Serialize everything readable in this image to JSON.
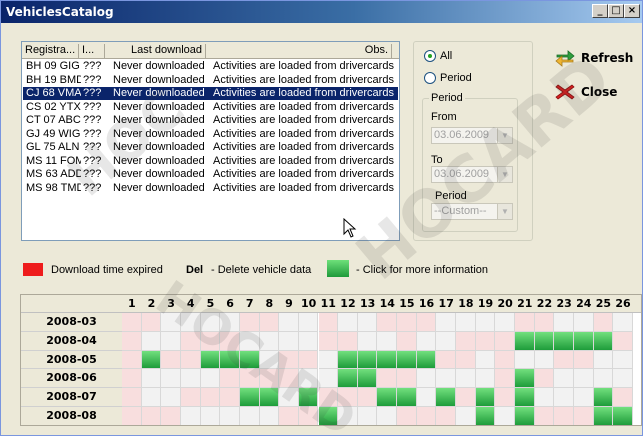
{
  "window": {
    "title": "VehiclesCatalog",
    "minimize": "_",
    "maximize": "□",
    "close": "×"
  },
  "list": {
    "columns": [
      "Registra...",
      "I...",
      "Last download",
      "Obs."
    ],
    "rows": [
      {
        "reg": "BH 09 GIG",
        "id": "???",
        "last": "Never downloaded",
        "obs": "Activities are loaded from drivercards"
      },
      {
        "reg": "BH 19 BMD",
        "id": "???",
        "last": "Never downloaded",
        "obs": "Activities are loaded from drivercards"
      },
      {
        "reg": "CJ 68 VMA",
        "id": "???",
        "last": "Never downloaded",
        "obs": "Activities are loaded from drivercards"
      },
      {
        "reg": "CS 02 YTX",
        "id": "???",
        "last": "Never downloaded",
        "obs": "Activities are loaded from drivercards"
      },
      {
        "reg": "CT 07 ABC",
        "id": "???",
        "last": "Never downloaded",
        "obs": "Activities are loaded from drivercards"
      },
      {
        "reg": "GJ 49 WIG",
        "id": "???",
        "last": "Never downloaded",
        "obs": "Activities are loaded from drivercards"
      },
      {
        "reg": "GL 75 ALN",
        "id": "???",
        "last": "Never downloaded",
        "obs": "Activities are loaded from drivercards"
      },
      {
        "reg": "MS 11 FOM",
        "id": "???",
        "last": "Never downloaded",
        "obs": "Activities are loaded from drivercards"
      },
      {
        "reg": "MS 63 ADD",
        "id": "???",
        "last": "Never downloaded",
        "obs": "Activities are loaded from drivercards"
      },
      {
        "reg": "MS 98 TMD",
        "id": "???",
        "last": "Never downloaded",
        "obs": "Activities are loaded from drivercards"
      }
    ],
    "selected_index": 2
  },
  "filter": {
    "all_label": "All",
    "period_label": "Period",
    "selected": "all",
    "group_title": "Period",
    "from_label": "From",
    "from_value": "03.06.2009",
    "to_label": "To",
    "to_value": "03.06.2009",
    "period_select_label": "Period",
    "period_select_value": "--Custom--"
  },
  "actions": {
    "refresh": "Refresh",
    "close": "Close"
  },
  "legend": {
    "expired_label": "Download time expired",
    "del_key": "Del",
    "del_label": "- Delete vehicle data",
    "info_label": "- Click for more information"
  },
  "calendar": {
    "days": [
      "1",
      "2",
      "3",
      "4",
      "5",
      "6",
      "7",
      "8",
      "9",
      "10",
      "11",
      "12",
      "13",
      "14",
      "15",
      "16",
      "17",
      "18",
      "19",
      "20",
      "21",
      "22",
      "23",
      "24",
      "25",
      "26"
    ],
    "months": [
      "2008-03",
      "2008-04",
      "2008-05",
      "2008-06",
      "2008-07",
      "2008-08"
    ],
    "expired": [
      [
        1,
        2,
        7,
        8,
        11,
        14,
        15,
        16,
        21,
        22,
        25
      ],
      [
        1,
        4,
        5,
        6,
        11,
        12,
        15,
        18,
        19,
        20,
        25,
        26
      ],
      [
        1,
        3,
        4,
        5,
        9,
        10,
        16,
        17,
        18,
        20,
        23,
        24
      ],
      [
        1,
        6,
        7,
        8,
        9,
        14,
        15,
        20,
        21,
        22
      ],
      [
        1,
        4,
        5,
        6,
        11,
        12,
        13,
        18,
        19,
        20,
        25,
        26
      ],
      [
        1,
        2,
        3,
        9,
        10,
        15,
        16,
        17,
        22,
        23,
        24
      ]
    ],
    "downloaded": [
      [],
      [
        21,
        22,
        23,
        24,
        25
      ],
      [
        2,
        5,
        6,
        7,
        12,
        13,
        14,
        15,
        16
      ],
      [
        12,
        13,
        21
      ],
      [
        7,
        8,
        10,
        14,
        15,
        17,
        19,
        21,
        25
      ],
      [
        11,
        19,
        21,
        25,
        26
      ]
    ]
  },
  "watermark": "HOCARD",
  "colors": {
    "expired": "#ee1c1c",
    "downloaded": "#3cc85a",
    "expired_cell": "#f8dede",
    "selection": "#0a246a",
    "refresh_icon": "#2e9e3e",
    "close_icon": "#d62020"
  }
}
